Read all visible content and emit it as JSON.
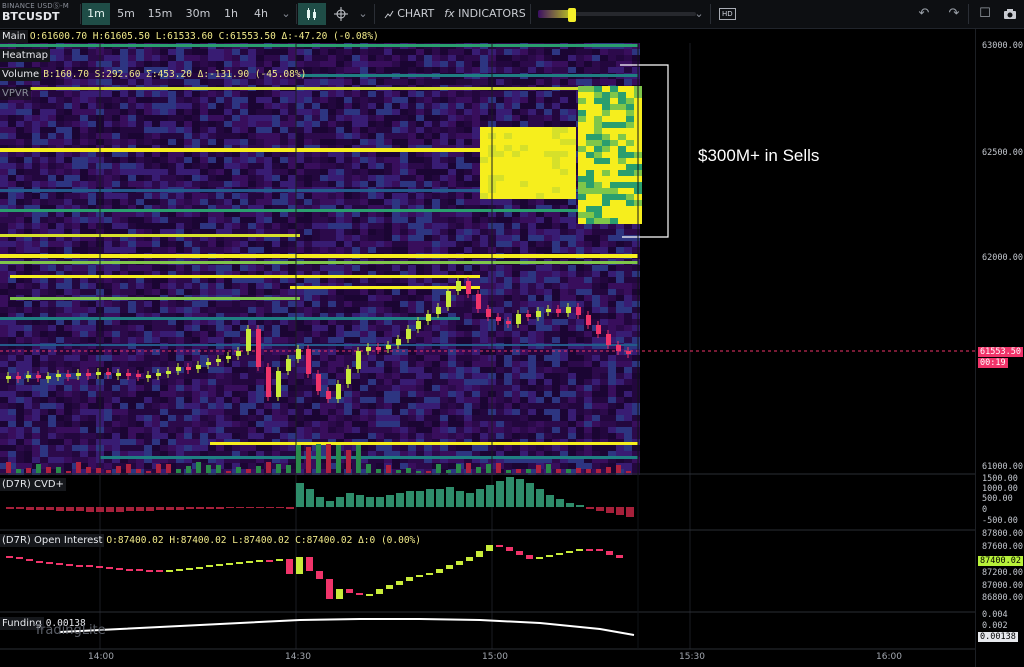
{
  "symbol": {
    "exchange": "BINANCE USDⓈ-M",
    "pair": "BTCUSDT"
  },
  "timeframes": [
    {
      "label": "1m",
      "active": true
    },
    {
      "label": "5m",
      "active": false
    },
    {
      "label": "15m",
      "active": false
    },
    {
      "label": "30m",
      "active": false
    },
    {
      "label": "1h",
      "active": false
    },
    {
      "label": "4h",
      "active": false
    }
  ],
  "toolbar": {
    "chart_label": "CHART",
    "indicators_label": "INDICATORS",
    "indicators_prefix": "fx",
    "hd_label": "HD"
  },
  "icons": [
    "chevron-down-icon",
    "candle-type-icon",
    "crosshair-icon",
    "undo-icon",
    "redo-icon",
    "fullscreen-icon",
    "camera-icon"
  ],
  "panels": {
    "main": {
      "label": "Main",
      "values": "O:61600.70 H:61605.50 L:61533.60 C:61553.50 Δ:-47.20 (-0.08%)"
    },
    "heatmap": {
      "label": "Heatmap"
    },
    "volume": {
      "label": "Volume",
      "values": "B:160.70 S:292.60 Σ:453.20 Δ:-131.90 (-45.08%)"
    },
    "vpvr": {
      "label": "VPVR"
    },
    "cvd": {
      "label": "(D7R) CVD+"
    },
    "oi": {
      "label": "(D7R) Open Interest",
      "values": "O:87400.02 H:87400.02 L:87400.02 C:87400.02 Δ:0 (0.00%)"
    },
    "funding": {
      "label": "Funding",
      "value": "0.00138"
    }
  },
  "watermark": "TradingLite",
  "annotation": "$300M+ in Sells",
  "price_axis": [
    "63000.00",
    "62500.00",
    "62000.00",
    "61000.00"
  ],
  "cvd_axis": [
    "1500.00",
    "1000.00",
    "500.00",
    "0",
    "-500.00"
  ],
  "oi_axis": [
    "87800.00",
    "87600.00",
    "87200.00",
    "87000.00",
    "86800.00"
  ],
  "funding_axis": [
    "0.004",
    "0.002"
  ],
  "last_price": "61553.50",
  "countdown": "00:19",
  "oi_last": "87400.02",
  "funding_last": "0.00138",
  "time_axis": [
    "14:00",
    "14:30",
    "15:00",
    "15:30",
    "16:00"
  ],
  "colors": {
    "up": "#c9ec3a",
    "down": "#f0346a",
    "heat_low": "#2a0a4a",
    "heat_high": "#f7f01e",
    "accent": "#1f4d47"
  }
}
